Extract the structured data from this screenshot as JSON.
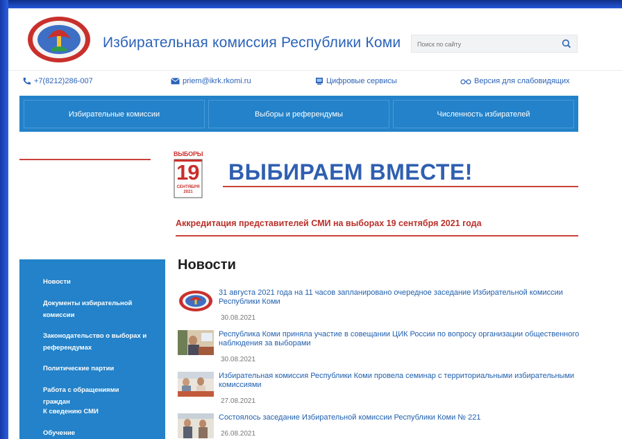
{
  "header": {
    "title": "Избирательная комиссия Республики Коми",
    "search_placeholder": "Поиск по сайту"
  },
  "contacts": {
    "phone": "+7(8212)286-007",
    "email": "priem@ikrk.rkomi.ru",
    "digital": "Цифровые сервисы",
    "accessibility": "Версия для слабовидящих"
  },
  "topnav": [
    "Избирательные комиссии",
    "Выборы и референдумы",
    "Численность избирателей"
  ],
  "banner": {
    "logo_word": "ВЫБОРЫ",
    "logo_day": "19",
    "logo_month": "СЕНТЯБРЯ",
    "logo_year": "2021",
    "slogan": "ВЫБИРАЕМ ВМЕСТЕ!",
    "accreditation": "Аккредитация представителей СМИ на выборах 19 сентября 2021 года"
  },
  "sidebar": [
    "Новости",
    "Документы избирательной комиссии",
    "Законодательство о выборах и референдумах",
    "Политические партии",
    "Работа с обращениями граждан",
    "К сведению СМИ",
    "Обучение"
  ],
  "news": {
    "title": "Новости",
    "items": [
      {
        "text": "31 августа 2021 года на 11 часов запланировано очередное заседание Избирательной комиссии Республики Коми",
        "date": "30.08.2021"
      },
      {
        "text": "Республика Коми приняла участие в совещании ЦИК России по вопросу организации общественного наблюдения за выборами",
        "date": "30.08.2021"
      },
      {
        "text": "Избирательная комиссия Республики Коми провела семинар с территориальными избирательными комиссиями",
        "date": "27.08.2021"
      },
      {
        "text": "Состоялось заседание Избирательной комиссии Республики Коми № 221",
        "date": "26.08.2021"
      }
    ]
  },
  "colors": {
    "accent_blue": "#2382c9",
    "title_blue": "#2a62b8",
    "red": "#c9423a"
  }
}
